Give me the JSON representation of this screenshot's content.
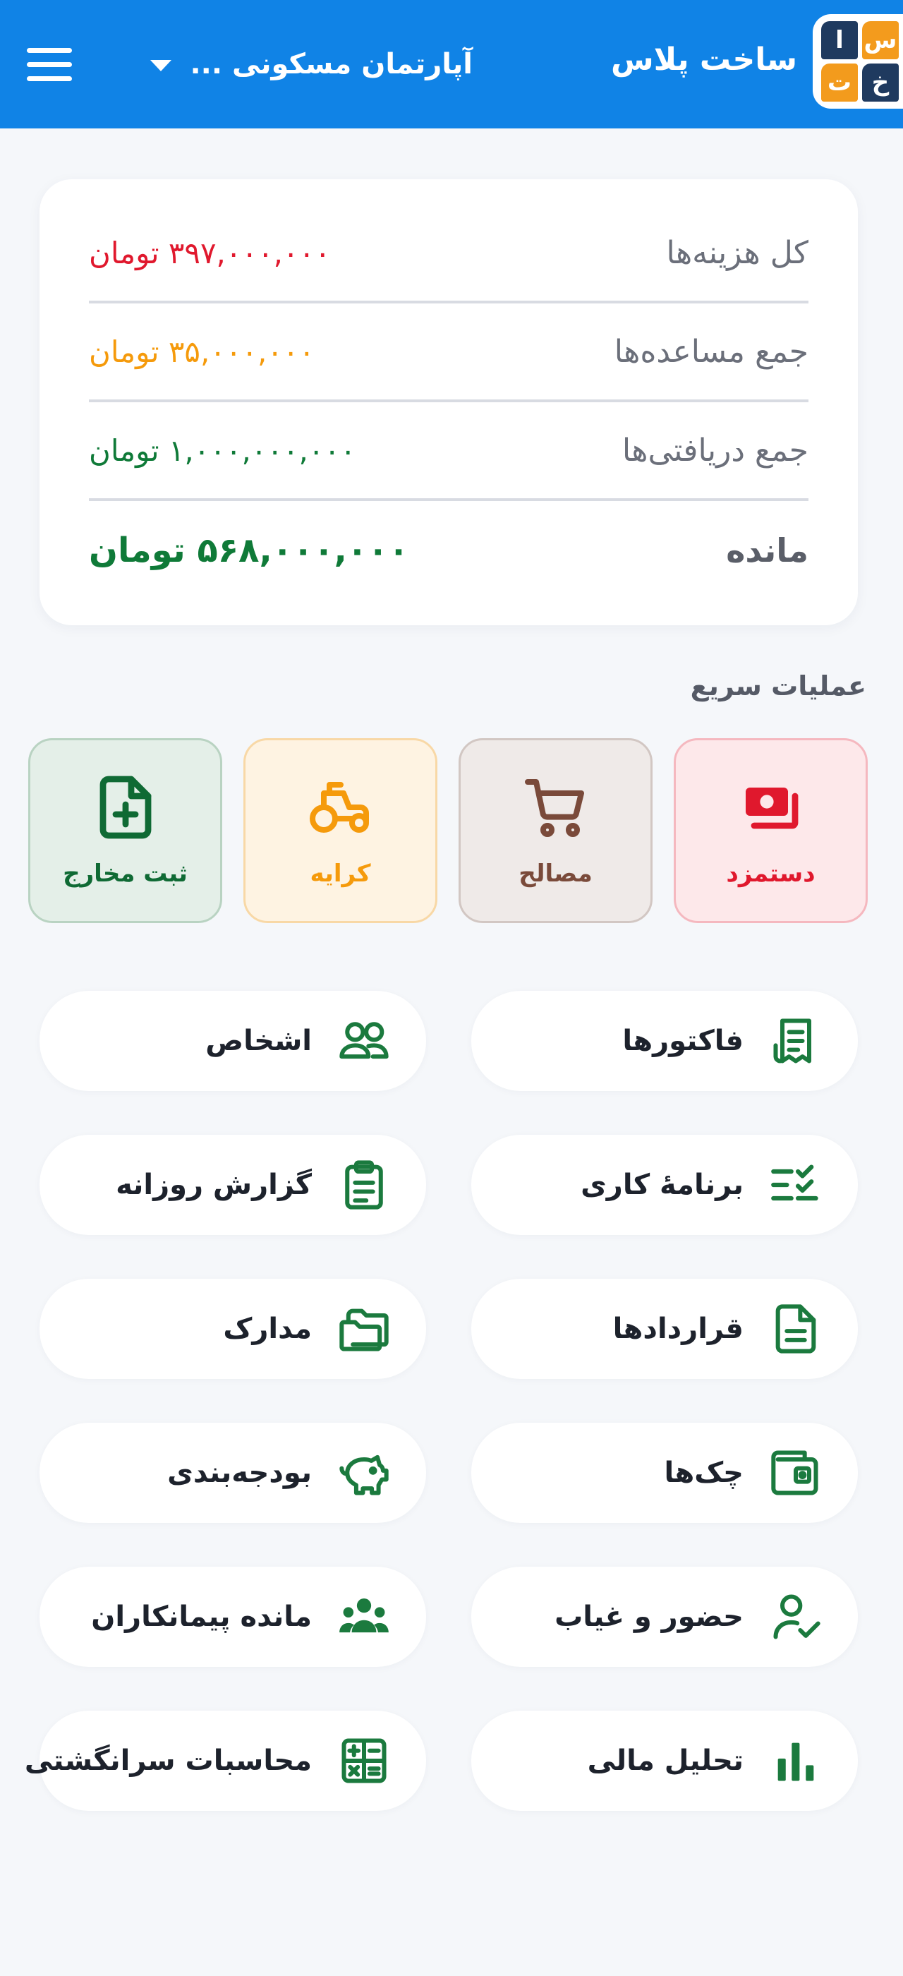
{
  "header": {
    "app_title": "ساخت پلاس",
    "project_name": "آپارتمان مسکونی ...",
    "logo_letters": [
      "س",
      "ا",
      "خ",
      "ت"
    ],
    "bg_color": "#1083e6"
  },
  "summary": {
    "rows": [
      {
        "label": "کل هزینه‌ها",
        "value": "۳۹۷,۰۰۰,۰۰۰ تومان",
        "color": "#e0182d"
      },
      {
        "label": "جمع مساعده‌ها",
        "value": "۳۵,۰۰۰,۰۰۰ تومان",
        "color": "#f59a0b"
      },
      {
        "label": "جمع دریافتی‌ها",
        "value": "۱,۰۰۰,۰۰۰,۰۰۰ تومان",
        "color": "#0f7a38"
      },
      {
        "label": "مانده",
        "value": "۵۶۸,۰۰۰,۰۰۰ تومان",
        "color": "#0f7a38"
      }
    ]
  },
  "quick_actions": {
    "title": "عملیات سریع",
    "items": [
      {
        "label": "دستمزد",
        "icon": "money-icon",
        "color": "#e0182d",
        "bg": "#fde8ea",
        "border": "#f5b8bf"
      },
      {
        "label": "مصالح",
        "icon": "cart-icon",
        "color": "#7a4a3a",
        "bg": "#efeae8",
        "border": "#d2c7c3"
      },
      {
        "label": "کرایه",
        "icon": "tractor-icon",
        "color": "#f59a0b",
        "bg": "#fef3e2",
        "border": "#f8d8a6"
      },
      {
        "label": "ثبت مخارج",
        "icon": "add-document-icon",
        "color": "#0f6a34",
        "bg": "#e4efe8",
        "border": "#b9d3c2"
      }
    ]
  },
  "menu": {
    "accent": "#1b7a3e",
    "items": [
      {
        "label": "فاکتورها",
        "icon": "receipt-icon"
      },
      {
        "label": "اشخاص",
        "icon": "people-icon"
      },
      {
        "label": "برنامهٔ کاری",
        "icon": "checklist-icon"
      },
      {
        "label": "گزارش روزانه",
        "icon": "clipboard-icon"
      },
      {
        "label": "قراردادها",
        "icon": "contract-icon"
      },
      {
        "label": "مدارک",
        "icon": "folder-icon"
      },
      {
        "label": "چک‌ها",
        "icon": "wallet-icon"
      },
      {
        "label": "بودجه‌بندی",
        "icon": "piggy-bank-icon"
      },
      {
        "label": "حضور و غیاب",
        "icon": "user-check-icon"
      },
      {
        "label": "مانده پیمانکاران",
        "icon": "group-icon"
      },
      {
        "label": "تحلیل مالی",
        "icon": "bar-chart-icon"
      },
      {
        "label": "محاسبات سرانگشتی",
        "icon": "calculator-icon"
      }
    ]
  }
}
